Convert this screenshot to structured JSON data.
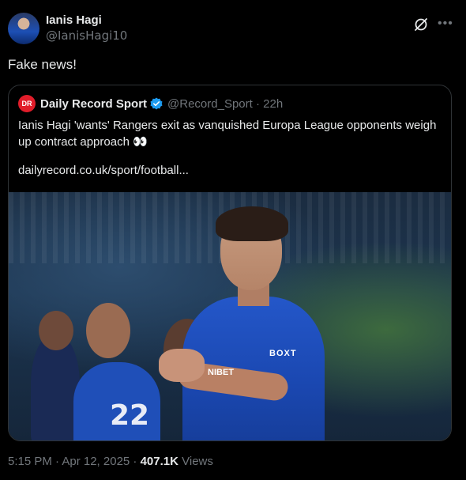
{
  "author": {
    "display_name": "Ianis Hagi",
    "handle": "@IanisHagi10"
  },
  "tweet": {
    "text": "Fake news!"
  },
  "quote": {
    "display_name": "Daily Record Sport",
    "handle_time": "@Record_Sport · 22h",
    "avatar_text": "DR",
    "text": "Ianis Hagi 'wants' Rangers exit as vanquished Europa League opponents weigh up contract approach 👀",
    "link": "dailyrecord.co.uk/sport/football...",
    "photo": {
      "sponsor_top": "BOXT",
      "sponsor_chest": "NIBET",
      "back_number": "22"
    }
  },
  "meta": {
    "time_date": "5:15 PM · Apr 12, 2025 · ",
    "views_count": "407.1K",
    "views_label": " Views"
  },
  "colors": {
    "background": "#000000",
    "text": "#e7e9ea",
    "muted": "#71767b",
    "verified": "#1d9bf0",
    "brand_red": "#e11d2a"
  },
  "icons": [
    "grok-icon",
    "more-icon",
    "verified-badge-icon"
  ]
}
